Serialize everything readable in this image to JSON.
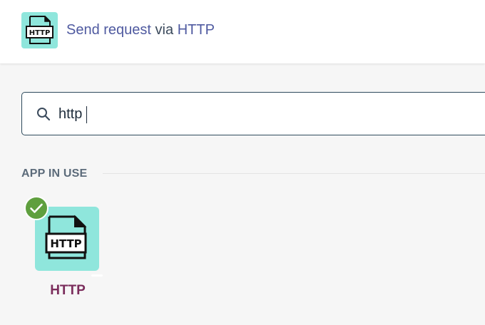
{
  "header": {
    "icon": "http-document-icon",
    "icon_text": "HTTP",
    "title_action": "Send request",
    "title_connector": "via",
    "title_app": "HTTP"
  },
  "search": {
    "value": "http",
    "icon": "search-icon"
  },
  "section": {
    "label": "APP IN USE"
  },
  "apps": [
    {
      "name": "HTTP",
      "icon_text": "HTTP",
      "selected": true,
      "icon": "http-document-icon",
      "badge_icon": "checkmark-icon"
    }
  ],
  "colors": {
    "icon_bg": "#8fe6dc",
    "link": "#4f5aa0",
    "app_name": "#7b2d5c",
    "check_badge": "#5f9f3e",
    "search_border": "#2e4a5c"
  }
}
